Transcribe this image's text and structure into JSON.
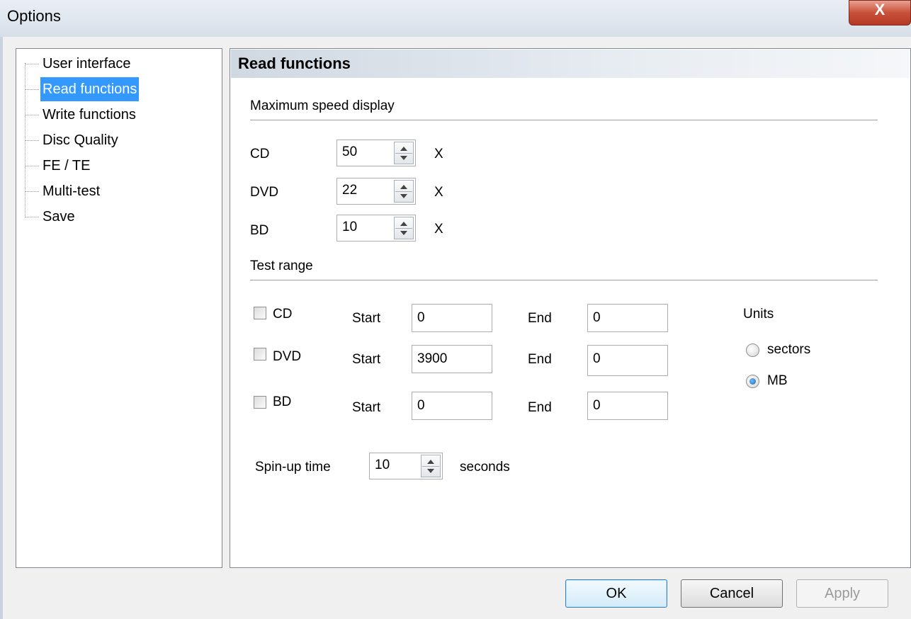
{
  "window": {
    "title": "Options",
    "close_label": "X"
  },
  "tree": {
    "items": [
      {
        "label": "User interface"
      },
      {
        "label": "Read functions",
        "selected": true
      },
      {
        "label": "Write functions"
      },
      {
        "label": "Disc Quality"
      },
      {
        "label": "FE / TE"
      },
      {
        "label": "Multi-test"
      },
      {
        "label": "Save"
      }
    ]
  },
  "panel": {
    "title": "Read functions",
    "max_speed": {
      "heading": "Maximum speed display",
      "rows": [
        {
          "label": "CD",
          "value": "50",
          "unit": "X"
        },
        {
          "label": "DVD",
          "value": "22",
          "unit": "X"
        },
        {
          "label": "BD",
          "value": "10",
          "unit": "X"
        }
      ]
    },
    "test_range": {
      "heading": "Test range",
      "start_label": "Start",
      "end_label": "End",
      "rows": [
        {
          "label": "CD",
          "checked": false,
          "start": "0",
          "end": "0"
        },
        {
          "label": "DVD",
          "checked": false,
          "start": "3900",
          "end": "0"
        },
        {
          "label": "BD",
          "checked": false,
          "start": "0",
          "end": "0"
        }
      ],
      "units": {
        "heading": "Units",
        "options": [
          {
            "label": "sectors",
            "selected": false
          },
          {
            "label": "MB",
            "selected": true
          }
        ]
      }
    },
    "spin_up": {
      "label": "Spin-up time",
      "value": "10",
      "unit": "seconds"
    }
  },
  "buttons": {
    "ok": "OK",
    "cancel": "Cancel",
    "apply": "Apply"
  }
}
